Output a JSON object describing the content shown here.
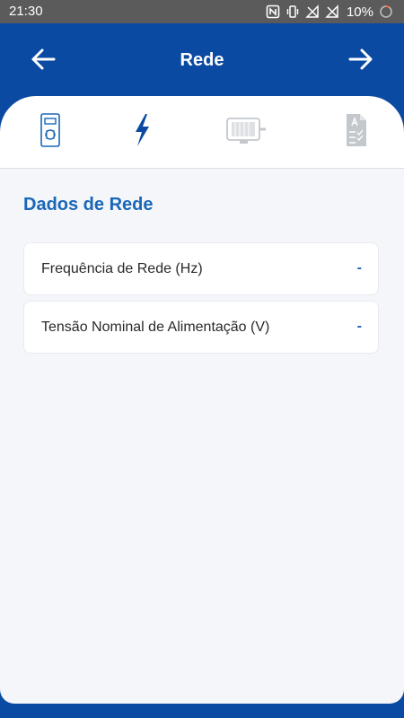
{
  "status_bar": {
    "time": "21:30",
    "battery_percent": "10%",
    "icons": [
      "nfc-icon",
      "vibrate-icon",
      "no-signal-icon",
      "no-signal-icon",
      "battery-ring-icon"
    ]
  },
  "header": {
    "title": "Rede",
    "back_icon": "arrow-left-icon",
    "forward_icon": "arrow-right-icon"
  },
  "tabs": [
    {
      "icon": "drive-device-icon",
      "state": "default"
    },
    {
      "icon": "lightning-bolt-icon",
      "state": "active"
    },
    {
      "icon": "motor-icon",
      "state": "disabled"
    },
    {
      "icon": "checklist-document-icon",
      "state": "disabled"
    }
  ],
  "section": {
    "title": "Dados de Rede"
  },
  "fields": [
    {
      "label": "Frequência de Rede (Hz)",
      "value": "-"
    },
    {
      "label": "Tensão Nominal de Alimentação (V)",
      "value": "-"
    }
  ],
  "colors": {
    "brand_blue": "#0b4aa2",
    "accent_blue": "#1a67b8",
    "disabled_gray": "#c4c7cc",
    "background": "#f4f6fa"
  }
}
